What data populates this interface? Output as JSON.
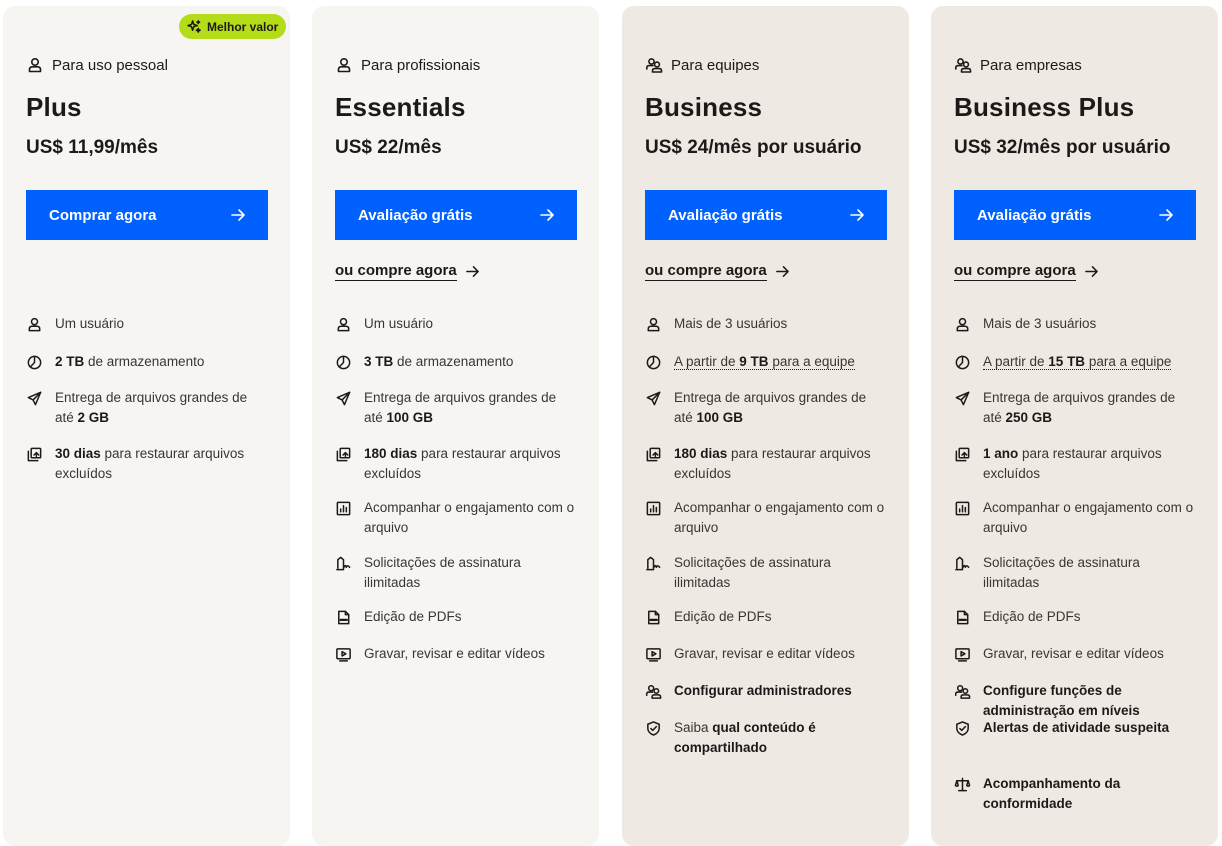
{
  "colors": {
    "cta": "#0061fe",
    "badge": "#b4dc19",
    "card_plus": "#f7f5f2",
    "card_essentials": "#f7f5f2",
    "card_business": "#eee9e2",
    "card_business_plus": "#eee9e2"
  },
  "plans": [
    {
      "badge": "Melhor valor",
      "eyebrow": "Para uso pessoal",
      "eyebrow_icon": "user-icon",
      "name": "Plus",
      "price": "US$ 11,99/mês",
      "cta": "Comprar agora",
      "features": [
        {
          "icon": "user-icon",
          "pre": "",
          "bold": "",
          "post": "Um usuário"
        },
        {
          "icon": "storage-icon",
          "pre": "",
          "bold": "2 TB",
          "post": " de armazenamento"
        },
        {
          "icon": "send-icon",
          "pre": "Entrega de arquivos grandes de até ",
          "bold": "2 GB",
          "post": ""
        },
        {
          "icon": "restore-icon",
          "pre": "",
          "bold": "30 dias",
          "post": " para restaurar arquivos excluídos"
        }
      ]
    },
    {
      "eyebrow": "Para profissionais",
      "eyebrow_icon": "user-icon",
      "name": "Essentials",
      "price": "US$ 22/mês",
      "cta": "Avaliação grátis",
      "buy_link": "ou compre agora",
      "features": [
        {
          "icon": "user-icon",
          "pre": "",
          "bold": "",
          "post": "Um usuário"
        },
        {
          "icon": "storage-icon",
          "pre": "",
          "bold": "3 TB",
          "post": " de armazenamento"
        },
        {
          "icon": "send-icon",
          "pre": "Entrega de arquivos grandes de até ",
          "bold": "100 GB",
          "post": ""
        },
        {
          "icon": "restore-icon",
          "pre": "",
          "bold": "180 dias",
          "post": " para restaurar arquivos excluídos"
        },
        {
          "icon": "analytics-icon",
          "pre": "",
          "bold": "",
          "post": "Acompanhar o engajamento com o arquivo"
        },
        {
          "icon": "signature-icon",
          "pre": "",
          "bold": "",
          "post": "Solicitações de assinatura ilimitadas"
        },
        {
          "icon": "pdf-icon",
          "pre": "",
          "bold": "",
          "post": "Edição de PDFs"
        },
        {
          "icon": "video-icon",
          "pre": "",
          "bold": "",
          "post": "Gravar, revisar e editar vídeos"
        }
      ]
    },
    {
      "eyebrow": "Para equipes",
      "eyebrow_icon": "team-icon",
      "name": "Business",
      "price": "US$ 24/mês por usuário",
      "cta": "Avaliação grátis",
      "buy_link": "ou compre agora",
      "features": [
        {
          "icon": "user-icon",
          "pre": "",
          "bold": "",
          "post": "Mais de 3 usuários"
        },
        {
          "icon": "storage-icon",
          "pre": "A partir de ",
          "bold": "9 TB",
          "post": " para a equipe",
          "dotted": true
        },
        {
          "icon": "send-icon",
          "pre": "Entrega de arquivos grandes de até ",
          "bold": "100 GB",
          "post": ""
        },
        {
          "icon": "restore-icon",
          "pre": "",
          "bold": "180 dias",
          "post": " para restaurar arquivos excluídos"
        },
        {
          "icon": "analytics-icon",
          "pre": "",
          "bold": "",
          "post": "Acompanhar o engajamento com o arquivo"
        },
        {
          "icon": "signature-icon",
          "pre": "",
          "bold": "",
          "post": "Solicitações de assinatura ilimitadas"
        },
        {
          "icon": "pdf-icon",
          "pre": "",
          "bold": "",
          "post": "Edição de PDFs"
        },
        {
          "icon": "video-icon",
          "pre": "",
          "bold": "",
          "post": "Gravar, revisar e editar vídeos"
        },
        {
          "icon": "admin-icon",
          "pre": "",
          "bold": "Configurar administradores",
          "post": ""
        },
        {
          "icon": "shield-icon",
          "pre": "Saiba ",
          "bold": "qual conteúdo é compartilhado",
          "post": ""
        }
      ]
    },
    {
      "eyebrow": "Para empresas",
      "eyebrow_icon": "team-icon",
      "name": "Business Plus",
      "price": "US$ 32/mês por usuário",
      "cta": "Avaliação grátis",
      "buy_link": "ou compre agora",
      "features": [
        {
          "icon": "user-icon",
          "pre": "",
          "bold": "",
          "post": "Mais de 3 usuários"
        },
        {
          "icon": "storage-icon",
          "pre": "A partir de ",
          "bold": "15 TB",
          "post": " para a equipe",
          "dotted": true
        },
        {
          "icon": "send-icon",
          "pre": "Entrega de arquivos grandes de até ",
          "bold": "250 GB",
          "post": ""
        },
        {
          "icon": "restore-icon",
          "pre": "",
          "bold": "1 ano",
          "post": " para restaurar arquivos excluídos"
        },
        {
          "icon": "analytics-icon",
          "pre": "",
          "bold": "",
          "post": "Acompanhar o engajamento com o arquivo"
        },
        {
          "icon": "signature-icon",
          "pre": "",
          "bold": "",
          "post": "Solicitações de assinatura ilimitadas"
        },
        {
          "icon": "pdf-icon",
          "pre": "",
          "bold": "",
          "post": "Edição de PDFs"
        },
        {
          "icon": "video-icon",
          "pre": "",
          "bold": "",
          "post": "Gravar, revisar e editar vídeos"
        },
        {
          "icon": "admin-icon",
          "pre": "",
          "bold": "Configure funções de administração em níveis",
          "post": ""
        },
        {
          "icon": "shield-icon",
          "pre": "",
          "bold": "Alertas de atividade suspeita",
          "post": ""
        },
        {
          "icon": "compliance-icon",
          "pre": "",
          "bold": "Acompanhamento da conformidade",
          "post": ""
        }
      ]
    }
  ]
}
